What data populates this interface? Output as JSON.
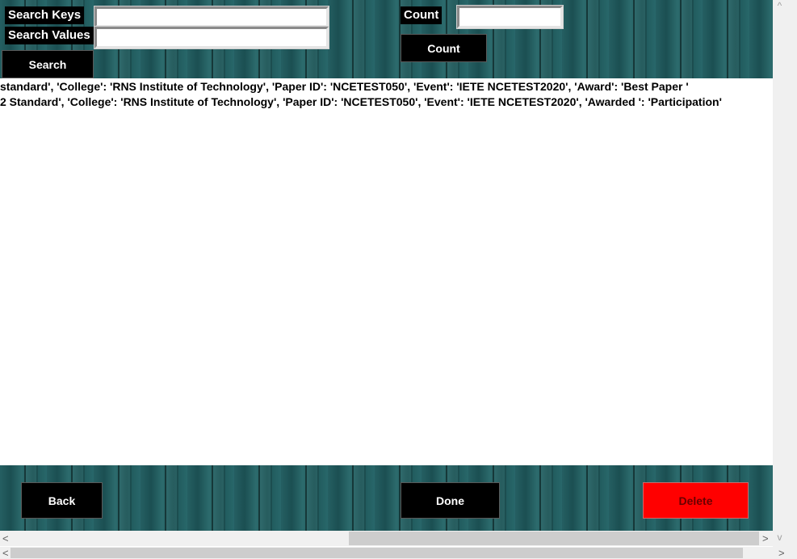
{
  "search": {
    "keys_label": "Search Keys",
    "values_label": "Search Values",
    "keys_value": "",
    "values_value": "",
    "button_label": "Search"
  },
  "count": {
    "label": "Count",
    "value": "",
    "button_label": "Count"
  },
  "results": [
    " standard', 'College': 'RNS Institute of Technology', 'Paper ID': 'NCETEST050', 'Event': 'IETE NCETEST2020', 'Award': 'Best Paper '",
    "2 Standard', 'College': 'RNS Institute of Technology', 'Paper ID': 'NCETEST050', 'Event': 'IETE NCETEST2020', 'Awarded ': 'Participation'"
  ],
  "footer": {
    "back_label": "Back",
    "done_label": "Done",
    "delete_label": "Delete"
  },
  "colors": {
    "delete_button": "#ff0000",
    "button": "#000000",
    "background_panel": "#1f5e5f"
  },
  "scrollbars": {
    "left_arrow": "<",
    "right_arrow": ">",
    "up_arrow": "^",
    "down_arrow": "v"
  }
}
